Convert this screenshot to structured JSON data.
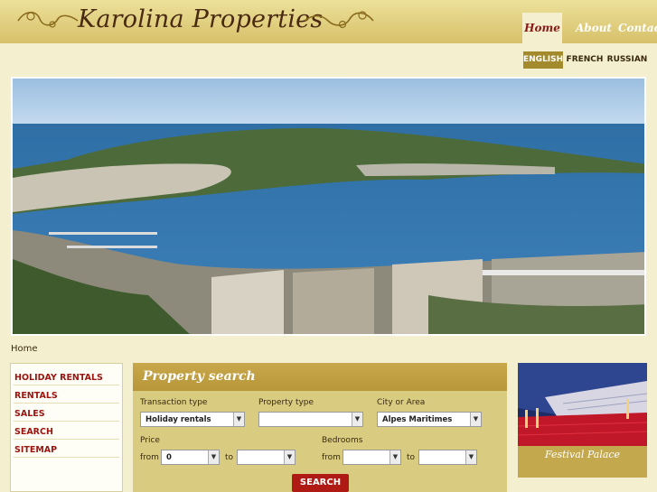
{
  "header": {
    "logo_text": "Karolina Properties",
    "nav": [
      {
        "label": "Home",
        "active": true
      },
      {
        "label": "About",
        "active": false
      },
      {
        "label": "Contact",
        "active": false
      }
    ]
  },
  "languages": [
    {
      "label": "ENGLISH",
      "active": true
    },
    {
      "label": "FRENCH",
      "active": false
    },
    {
      "label": "RUSSIAN",
      "active": false
    }
  ],
  "breadcrumb": "Home",
  "sidebar": {
    "items": [
      {
        "label": "HOLIDAY RENTALS"
      },
      {
        "label": "RENTALS"
      },
      {
        "label": "SALES"
      },
      {
        "label": "SEARCH"
      },
      {
        "label": "SITEMAP"
      }
    ]
  },
  "search": {
    "title": "Property search",
    "transaction_type_label": "Transaction type",
    "transaction_type_value": "Holiday rentals",
    "property_type_label": "Property type",
    "property_type_value": "",
    "city_label": "City or Area",
    "city_value": "Alpes Maritimes",
    "price_label": "Price",
    "bedrooms_label": "Bedrooms",
    "from_label": "from",
    "to_label": "to",
    "price_from_value": "0",
    "price_to_value": "",
    "bedrooms_from_value": "",
    "bedrooms_to_value": "",
    "button_label": "SEARCH"
  },
  "promo": {
    "caption": "Festival Palace"
  },
  "colors": {
    "accent_red": "#9a1410",
    "header_gold": "#d7c16a",
    "panel_gold": "#d9cc80"
  }
}
